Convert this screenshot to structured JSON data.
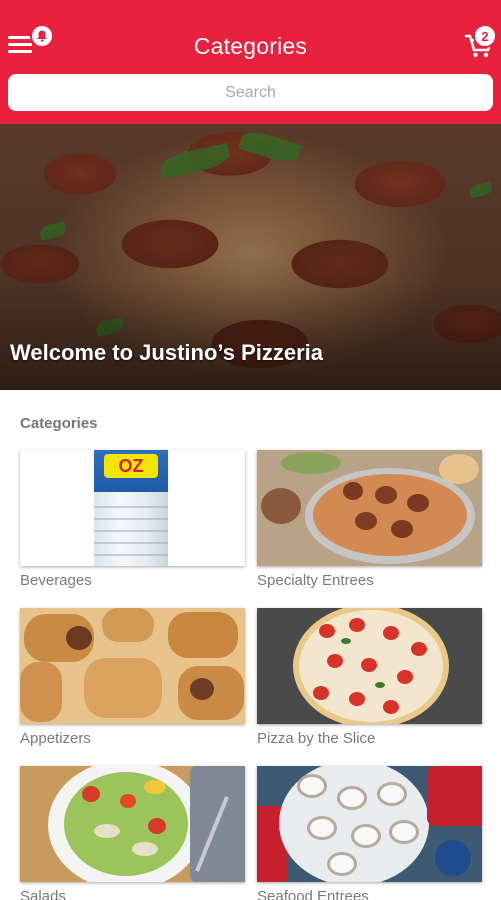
{
  "header": {
    "title": "Categories",
    "menu_icon": "hamburger-menu-icon",
    "notification_icon": "bell-icon",
    "cart_icon": "cart-icon",
    "cart_count": "2",
    "accent_color": "#e8213f"
  },
  "search": {
    "placeholder": "Search",
    "value": ""
  },
  "hero": {
    "welcome": "Welcome to Justino’s Pizzeria"
  },
  "categories": {
    "heading": "Categories",
    "items": [
      {
        "label": "Beverages"
      },
      {
        "label": "Specialty Entrees"
      },
      {
        "label": "Appetizers"
      },
      {
        "label": "Pizza by the Slice"
      },
      {
        "label": "Salads"
      },
      {
        "label": "Seafood Entrees"
      }
    ]
  }
}
